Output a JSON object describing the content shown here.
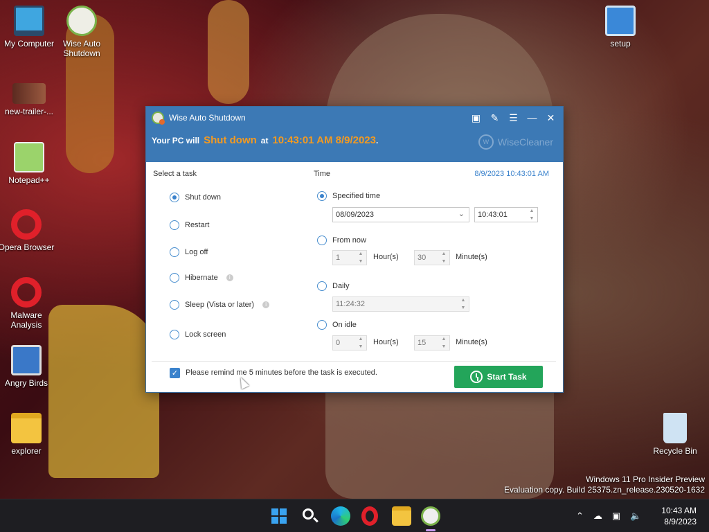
{
  "desktop": {
    "icons": [
      {
        "label": "My Computer",
        "icon": "monitor-icon",
        "color": "#3fa6e0"
      },
      {
        "label": "Wise Auto Shutdown",
        "icon": "alarm-clock-icon",
        "color": "#7ab24a"
      },
      {
        "label": "new-trailer-...",
        "icon": "video-thumbnail-icon",
        "color": "#5b2a20"
      },
      {
        "label": "Notepad++",
        "icon": "notepad-icon",
        "color": "#9bd36b"
      },
      {
        "label": "Opera Browser",
        "icon": "opera-icon",
        "color": "#e0202a"
      },
      {
        "label": "Malware Analysis",
        "icon": "opera-icon",
        "color": "#e0202a"
      },
      {
        "label": "Angry Birds",
        "icon": "installer-icon",
        "color": "#3a78c8"
      },
      {
        "label": "explorer",
        "icon": "folder-icon",
        "color": "#f3c440"
      },
      {
        "label": "setup",
        "icon": "setup-icon",
        "color": "#3a88d8"
      },
      {
        "label": "Recycle Bin",
        "icon": "recycle-bin-icon",
        "color": "#cfe3f3"
      }
    ],
    "watermark": {
      "line1": "Windows 11 Pro Insider Preview",
      "line2": "Evaluation copy. Build 25375.zn_release.230520-1632"
    }
  },
  "window": {
    "title": "Wise Auto Shutdown",
    "status": {
      "prefix": "Your PC will",
      "action": "Shut down",
      "at": "at",
      "time": "10:43:01 AM 8/9/2023",
      "suffix": "."
    },
    "brand": "WiseCleaner",
    "titlebar_buttons": [
      "feedback-icon",
      "edit-icon",
      "menu-icon",
      "minimize-icon",
      "close-icon"
    ],
    "accent_color": "#3c79b5",
    "highlight_color": "#f39a21",
    "task_section": {
      "title": "Select a task",
      "options": [
        {
          "label": "Shut down",
          "selected": true
        },
        {
          "label": "Restart",
          "selected": false
        },
        {
          "label": "Log off",
          "selected": false
        },
        {
          "label": "Hibernate",
          "selected": false,
          "info": true
        },
        {
          "label": "Sleep (Vista or later)",
          "selected": false,
          "info": true
        },
        {
          "label": "Lock screen",
          "selected": false
        }
      ]
    },
    "time_section": {
      "title": "Time",
      "current": "8/9/2023 10:43:01 AM",
      "specified": {
        "label": "Specified time",
        "selected": true,
        "date": "08/09/2023",
        "time": "10:43:01"
      },
      "from_now": {
        "label": "From now",
        "selected": false,
        "hours": "1",
        "hours_unit": "Hour(s)",
        "minutes": "30",
        "minutes_unit": "Minute(s)"
      },
      "daily": {
        "label": "Daily",
        "selected": false,
        "time": "11:24:32"
      },
      "on_idle": {
        "label": "On idle",
        "selected": false,
        "hours": "0",
        "hours_unit": "Hour(s)",
        "minutes": "15",
        "minutes_unit": "Minute(s)"
      }
    },
    "reminder": {
      "checked": true,
      "text": "Please remind me 5 minutes before the task is executed."
    },
    "start_button": "Start Task",
    "start_color": "#23a55a"
  },
  "taskbar": {
    "apps": [
      "windows-start-icon",
      "search-icon",
      "edge-icon",
      "opera-icon",
      "file-explorer-icon",
      "wise-auto-shutdown-icon"
    ],
    "tray_icons": [
      "chevron-up-icon",
      "cloud-off-icon",
      "network-icon",
      "volume-icon"
    ],
    "time": "10:43 AM",
    "date": "8/9/2023"
  }
}
